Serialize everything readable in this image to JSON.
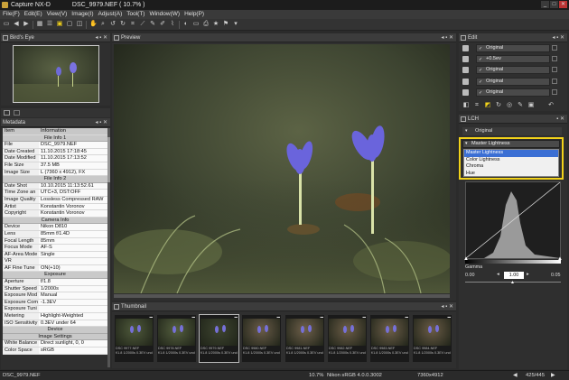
{
  "window": {
    "title": "Capture NX-D",
    "document": "DSC_9979.NEF ( 10.7% )",
    "controls": [
      "_",
      "□",
      "✕"
    ]
  },
  "menu": [
    "File(F)",
    "Edit(E)",
    "View(V)",
    "Image(I)",
    "Adjust(A)",
    "Tool(T)",
    "Window(W)",
    "Help(P)"
  ],
  "birds_eye": {
    "title": "Bird's Eye"
  },
  "metadata": {
    "title": "Metadata",
    "col_item": "Item",
    "col_info": "Information",
    "groups": [
      {
        "name": "File Info 1",
        "rows": [
          [
            "File",
            "DSC_9979.NEF"
          ],
          [
            "Date Created",
            "11.10.2015 17:18:45"
          ],
          [
            "Date Modified",
            "11.10.2015 17:13:52"
          ],
          [
            "File Size",
            "37.5 MB"
          ],
          [
            "Image Size",
            "L (7360 x 4912), FX"
          ]
        ]
      },
      {
        "name": "File Info 2",
        "rows": [
          [
            "Date Shot",
            "10.10.2015 11:13:52.61"
          ],
          [
            "Time Zone an",
            "UTC+3, DST:OFF"
          ],
          [
            "Image Quality",
            "Lossless Compressed RAW"
          ],
          [
            "Artist",
            "Konstantin Voronov"
          ],
          [
            "Copyright",
            "Konstantin Voronov"
          ]
        ]
      },
      {
        "name": "Camera Info",
        "rows": [
          [
            "Device",
            "Nikon D810"
          ],
          [
            "Lens",
            "85mm f/1.4D"
          ],
          [
            "Focal Length",
            "85mm"
          ],
          [
            "Focus Mode",
            "AF-S"
          ],
          [
            "AF-Area Mode",
            "Single"
          ],
          [
            "VR",
            ""
          ],
          [
            "AF Fine Tune",
            "ON(+10)"
          ]
        ]
      },
      {
        "name": "Exposure",
        "rows": [
          [
            "Aperture",
            "f/1.8"
          ],
          [
            "Shutter Speed",
            "1/2000s"
          ],
          [
            "Exposure Mod",
            "Manual"
          ],
          [
            "Exposure Com",
            "-1.3EV"
          ],
          [
            "Exposure Tuni",
            ""
          ],
          [
            "Metering",
            "Highlight-Weighted"
          ],
          [
            "ISO Sensitivity",
            "0.3EV under 64"
          ]
        ]
      },
      {
        "name": "Device",
        "rows": []
      },
      {
        "name": "Image Settings",
        "rows": [
          [
            "White Balance",
            "Direct sunlight, 0, 0"
          ],
          [
            "Color Space",
            "sRGB"
          ]
        ]
      }
    ]
  },
  "preview": {
    "title": "Preview"
  },
  "thumbnail": {
    "title": "Thumbnail",
    "items": [
      {
        "name": "DSC 9977.NEF",
        "info": "f/1.8 1/2000s 0.3EV und..."
      },
      {
        "name": "DSC 9978.NEF",
        "info": "f/1.8 1/2000s 0.3EV und..."
      },
      {
        "name": "DSC 9979.NEF",
        "info": "f/1.8 1/2000s 0.3EV und..."
      },
      {
        "name": "DSC 9980.NEF",
        "info": "f/1.8 1/2000s 0.3EV und..."
      },
      {
        "name": "DSC 9981.NEF",
        "info": "f/1.8 1/2000s 0.3EV und..."
      },
      {
        "name": "DSC 9982.NEF",
        "info": "f/1.8 1/2000s 0.3EV und..."
      },
      {
        "name": "DSC 9983.NEF",
        "info": "f/1.8 1/2000s 0.3EV und..."
      },
      {
        "name": "DSC 9984.NEF",
        "info": "f/1.8 1/2000s 0.3EV und..."
      }
    ]
  },
  "edit": {
    "title": "Edit",
    "rows": [
      "Original",
      "+0.5ev",
      "Original",
      "Original",
      "Original"
    ]
  },
  "lch": {
    "title": "LCH",
    "version": "Original",
    "channel_selected": "Master Lightness",
    "channel_options": [
      "Master Lightness",
      "Color Lightness",
      "Chroma",
      "Hue"
    ],
    "gamma_label": "Gamma",
    "gamma_value": "1.00",
    "range_min": "0.00",
    "range_max": "0.05"
  },
  "status": {
    "file": "DSC_9979.NEF",
    "zoom": "10.7%",
    "profile": "Nikon sRGB 4.0.0.3002",
    "dimensions": "7360x4912",
    "page": "425/445"
  },
  "colors": {
    "accent": "#f2d21a",
    "panel": "#3c3c3c",
    "background": "#2b2b2b"
  }
}
